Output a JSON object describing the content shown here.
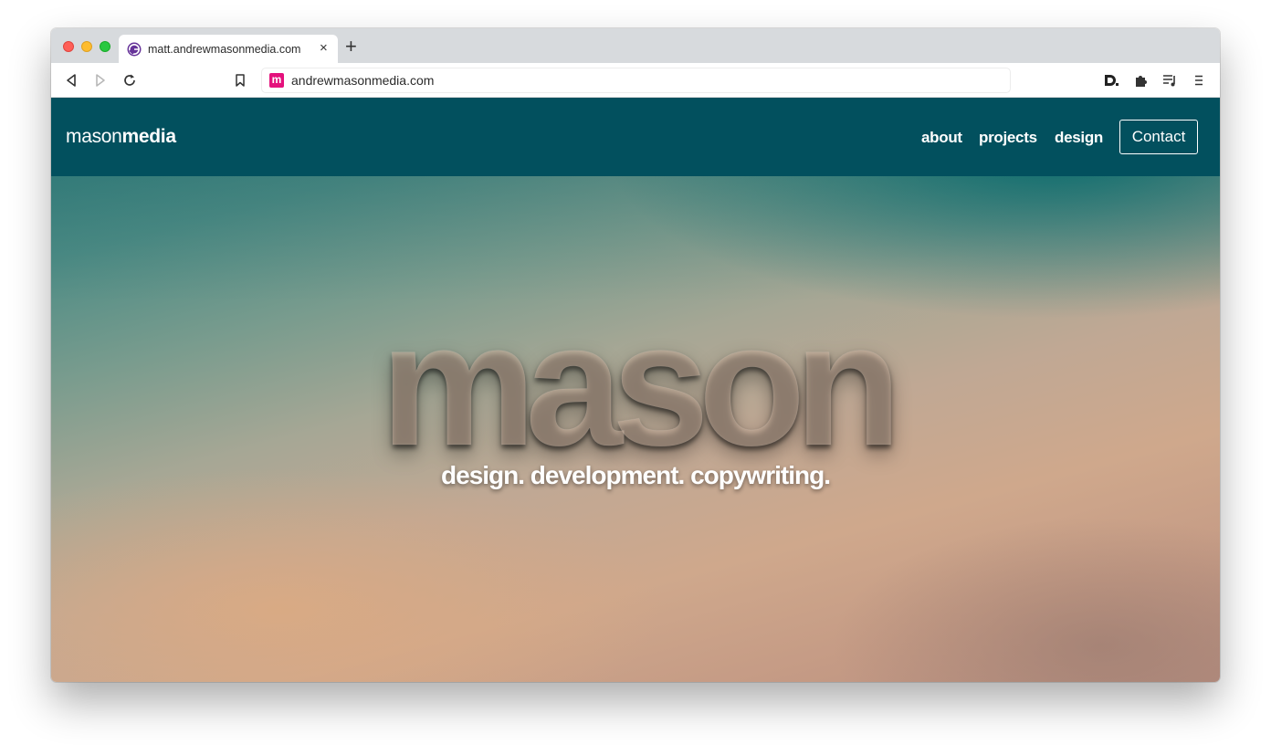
{
  "browser": {
    "tab": {
      "title": "matt.andrewmasonmedia.com",
      "favicon": "gatsby-icon",
      "close_label": "×"
    },
    "new_tab_label": "+",
    "toolbar": {
      "icons": [
        "back-icon",
        "forward-icon",
        "reload-icon",
        "bookmark-icon",
        "extension-d-icon",
        "puzzle-icon",
        "media-queue-icon",
        "menu-icon"
      ]
    },
    "address_bar": {
      "favicon_letter": "m",
      "url": "andrewmasonmedia.com"
    }
  },
  "page": {
    "navbar": {
      "brand_light": "mason",
      "brand_bold": "media",
      "links": [
        "about",
        "projects",
        "design"
      ],
      "contact_label": "Contact",
      "background": "#02505e"
    },
    "hero": {
      "headline": "mason",
      "tagline": "design. development. copywriting."
    }
  }
}
